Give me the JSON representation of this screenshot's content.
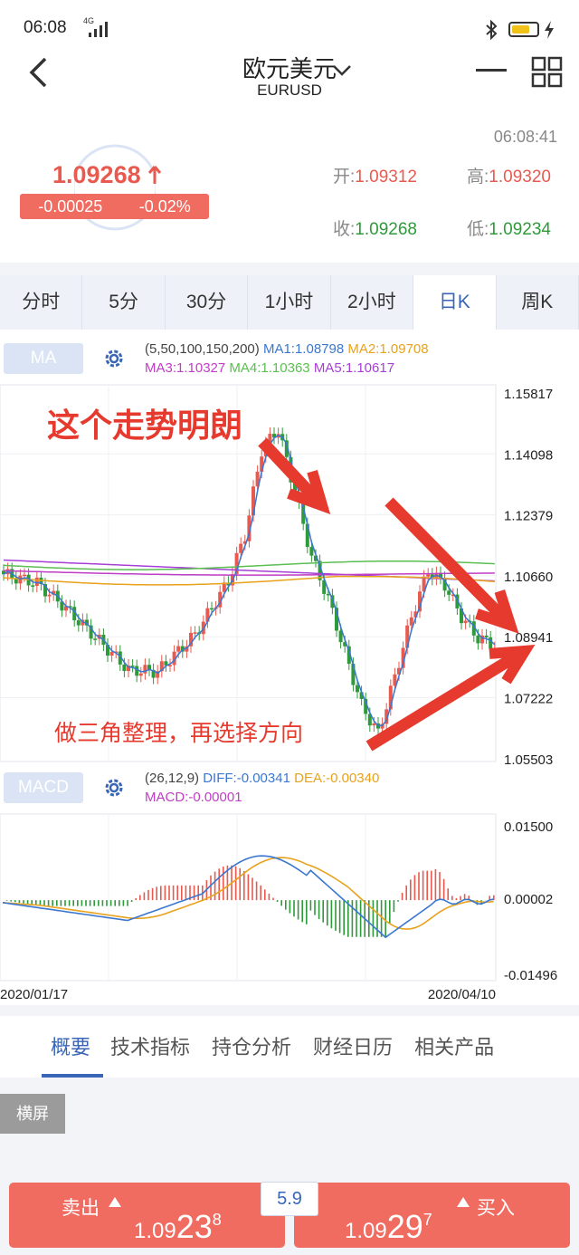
{
  "status_bar": {
    "time": "06:08",
    "network": "4G",
    "battery_icon": "battery-icon"
  },
  "header": {
    "title": "欧元美元",
    "symbol": "EURUSD"
  },
  "quote": {
    "price": "1.09268",
    "change": "-0.00025",
    "change_pct": "-0.02%",
    "time": "06:08:41",
    "open_label": "开:",
    "open": "1.09312",
    "high_label": "高:",
    "high": "1.09320",
    "close_label": "收:",
    "close": "1.09268",
    "low_label": "低:",
    "low": "1.09234"
  },
  "period_tabs": [
    "分时",
    "5分",
    "30分",
    "1小时",
    "2小时",
    "日K",
    "周K"
  ],
  "active_period": "日K",
  "ma_panel": {
    "button": "MA",
    "params": "(5,50,100,150,200)",
    "ma1": "MA1:1.08798",
    "ma2": "MA2:1.09708",
    "ma3": "MA3:1.10327",
    "ma4": "MA4:1.10363",
    "ma5": "MA5:1.10617",
    "y_ticks": [
      "1.15817",
      "1.14098",
      "1.12379",
      "1.10660",
      "1.08941",
      "1.07222",
      "1.05503"
    ]
  },
  "annotations": {
    "top": "这个走势明朗",
    "bottom": "做三角整理，再选择方向"
  },
  "macd_panel": {
    "button": "MACD",
    "params": "(26,12,9)",
    "diff": "DIFF:-0.00341",
    "dea": "DEA:-0.00340",
    "macd": "MACD:-0.00001",
    "y_ticks": [
      "0.01500",
      "0.00002",
      "-0.01496"
    ],
    "x_start": "2020/01/17",
    "x_end": "2020/04/10"
  },
  "bottom_tabs": [
    "概要",
    "技术指标",
    "持仓分析",
    "财经日历",
    "相关产品"
  ],
  "landscape_button": "横屏",
  "trade": {
    "sell_label": "卖出",
    "sell_main": "1.09",
    "sell_big": "23",
    "sell_sup": "8",
    "spread": "5.9",
    "buy_label": "买入",
    "buy_main": "1.09",
    "buy_big": "29",
    "buy_sup": "7"
  },
  "colors": {
    "up": "#e85a4f",
    "down": "#2f9a3a",
    "accent": "#3a66b7",
    "ma1": "#3a77d1",
    "ma2": "#e8a21c",
    "ma3": "#c03dc5",
    "ma4": "#5bbf52",
    "ma5": "#a63fd6"
  }
}
